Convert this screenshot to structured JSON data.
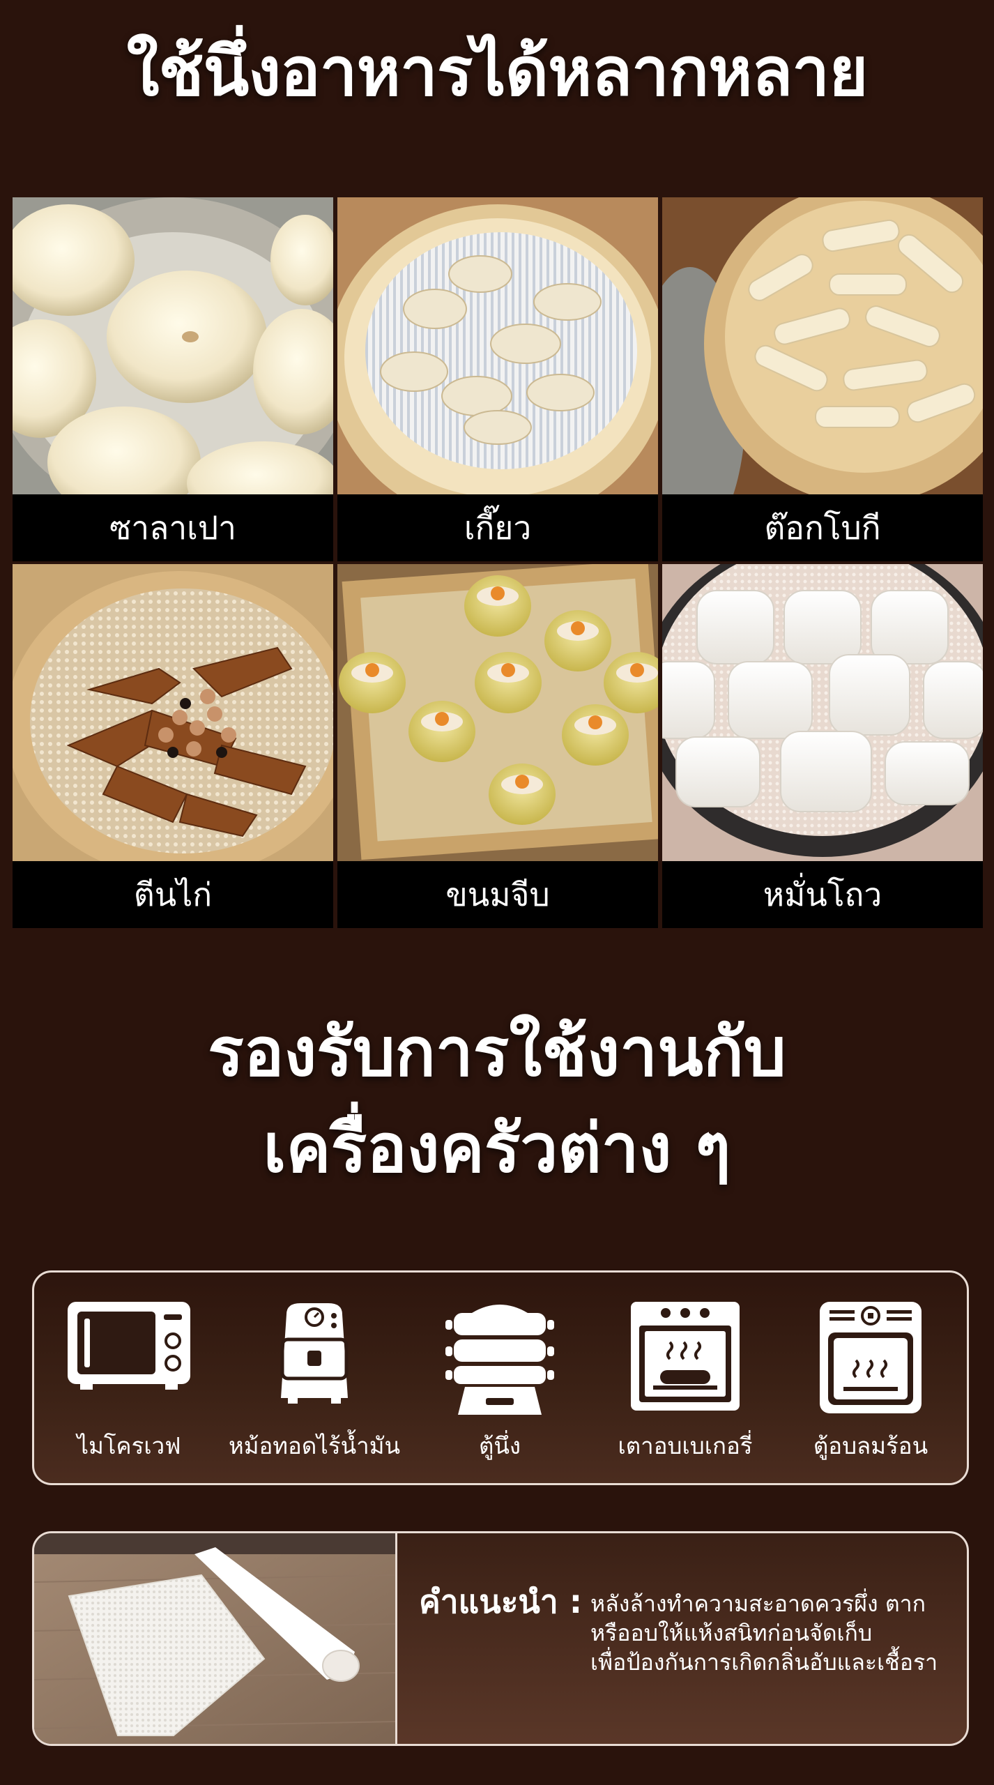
{
  "header": {
    "title": "ใช้นึ่งอาหารได้หลากหลาย"
  },
  "foods": [
    {
      "label": "ซาลาเปา",
      "icon": "bao-bun-photo"
    },
    {
      "label": "เกี๊ยว",
      "icon": "dumpling-photo"
    },
    {
      "label": "ต๊อกโบกี",
      "icon": "tteokbokki-photo"
    },
    {
      "label": "ตีนไก่",
      "icon": "chicken-feet-photo"
    },
    {
      "label": "ขนมจีบ",
      "icon": "shumai-photo"
    },
    {
      "label": "หมั่นโถว",
      "icon": "mantou-photo"
    }
  ],
  "section2": {
    "title_line1": "รองรับการใช้งานกับ",
    "title_line2": "เครื่องครัวต่าง ๆ"
  },
  "appliances": [
    {
      "label": "ไมโครเวฟ",
      "icon": "microwave-icon"
    },
    {
      "label": "หม้อทอดไร้น้ำมัน",
      "icon": "air-fryer-icon"
    },
    {
      "label": "ตู้นึ่ง",
      "icon": "steamer-icon"
    },
    {
      "label": "เตาอบเบเกอรี่",
      "icon": "bakery-oven-icon"
    },
    {
      "label": "ตู้อบลมร้อน",
      "icon": "convection-oven-icon"
    }
  ],
  "tip": {
    "heading": "คำแนะนำ :",
    "lines": [
      "หลังล้างทำความสะอาดควรผึ่ง ตาก",
      "หรืออบให้แห้งสนิทก่อนจัดเก็บ",
      "เพื่อป้องกันการเกิดกลิ่นอับและเชื้อรา"
    ]
  },
  "colors": {
    "background": "#2a130c",
    "panel_border": "#e9dcd4",
    "label_bar": "#000000",
    "text": "#ffffff"
  }
}
